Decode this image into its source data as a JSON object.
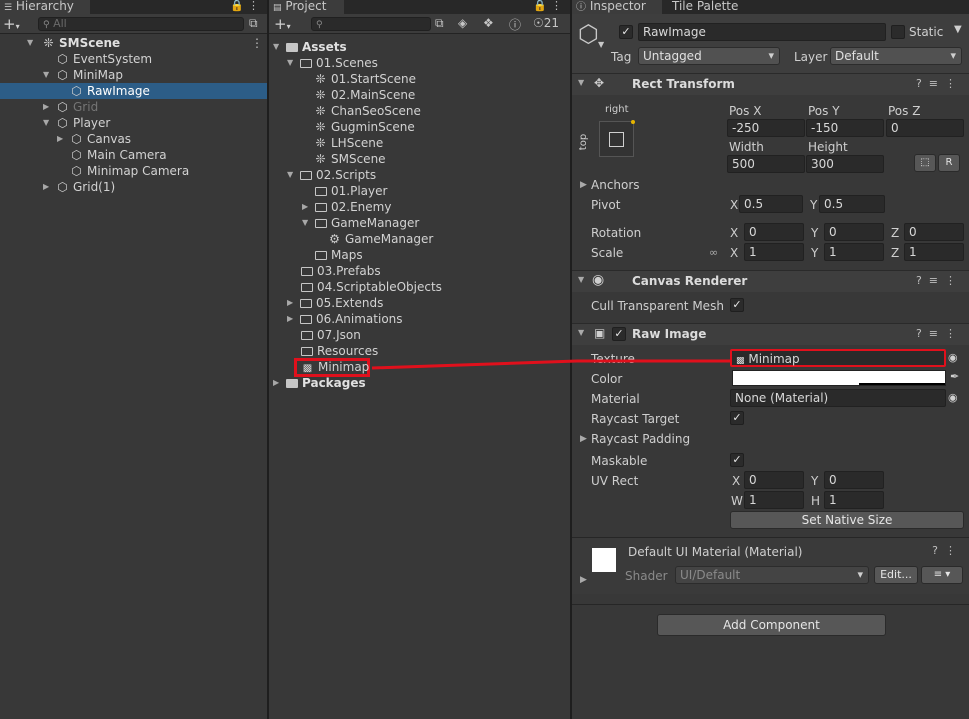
{
  "colors": {
    "panel_bg": "#383838",
    "tab_bg": "#282828",
    "selection": "#2c5d87",
    "annotation_red": "#e0101c",
    "field_bg": "#2a2a2a"
  },
  "hierarchy": {
    "tab": "Hierarchy",
    "search_placeholder": "All",
    "items": [
      {
        "label": "SMScene"
      },
      {
        "label": "EventSystem"
      },
      {
        "label": "MiniMap"
      },
      {
        "label": "RawImage"
      },
      {
        "label": "Grid"
      },
      {
        "label": "Player"
      },
      {
        "label": "Canvas"
      },
      {
        "label": "Main Camera"
      },
      {
        "label": "Minimap Camera"
      },
      {
        "label": "Grid(1)"
      }
    ]
  },
  "project": {
    "tab": "Project",
    "hidden_count": "21",
    "items": [
      {
        "label": "Assets"
      },
      {
        "label": "01.Scenes"
      },
      {
        "label": "01.StartScene"
      },
      {
        "label": "02.MainScene"
      },
      {
        "label": "ChanSeoScene"
      },
      {
        "label": "GugminScene"
      },
      {
        "label": "LHScene"
      },
      {
        "label": "SMScene"
      },
      {
        "label": "02.Scripts"
      },
      {
        "label": "01.Player"
      },
      {
        "label": "02.Enemy"
      },
      {
        "label": "GameManager"
      },
      {
        "label": "GameManager"
      },
      {
        "label": "Maps"
      },
      {
        "label": "03.Prefabs"
      },
      {
        "label": "04.ScriptableObjects"
      },
      {
        "label": "05.Extends"
      },
      {
        "label": "06.Animations"
      },
      {
        "label": "07.Json"
      },
      {
        "label": "Resources"
      },
      {
        "label": "Minimap"
      },
      {
        "label": "Packages"
      }
    ]
  },
  "inspector": {
    "tabs": [
      "Inspector",
      "Tile Palette"
    ],
    "object_name": "RawImage",
    "static_label": "Static",
    "tag_label": "Tag",
    "tag_value": "Untagged",
    "layer_label": "Layer",
    "layer_value": "Default",
    "rect_transform": {
      "title": "Rect Transform",
      "anchor_h": "right",
      "anchor_v": "top",
      "posx_label": "Pos X",
      "posx": "-250",
      "posy_label": "Pos Y",
      "posy": "-150",
      "posz_label": "Pos Z",
      "posz": "0",
      "width_label": "Width",
      "width": "500",
      "height_label": "Height",
      "height": "300",
      "r_button": "R",
      "anchors_label": "Anchors",
      "pivot_label": "Pivot",
      "pivot_x": "0.5",
      "pivot_y": "0.5",
      "rotation_label": "Rotation",
      "rot_x": "0",
      "rot_y": "0",
      "rot_z": "0",
      "scale_label": "Scale",
      "scale_x": "1",
      "scale_y": "1",
      "scale_z": "1",
      "x": "X",
      "y": "Y",
      "z": "Z"
    },
    "canvas_renderer": {
      "title": "Canvas Renderer",
      "cull_label": "Cull Transparent Mesh"
    },
    "raw_image": {
      "title": "Raw Image",
      "texture_label": "Texture",
      "texture_value": "Minimap",
      "color_label": "Color",
      "material_label": "Material",
      "material_value": "None (Material)",
      "raycast_target_label": "Raycast Target",
      "raycast_padding_label": "Raycast Padding",
      "maskable_label": "Maskable",
      "uvrect_label": "UV Rect",
      "uv_x": "0",
      "uv_y": "0",
      "uv_w": "1",
      "uv_h": "1",
      "w": "W",
      "h": "H",
      "native_size_button": "Set Native Size"
    },
    "material": {
      "title": "Default UI Material (Material)",
      "shader_label": "Shader",
      "shader_value": "UI/Default",
      "edit_button": "Edit..."
    },
    "add_component_button": "Add Component"
  }
}
